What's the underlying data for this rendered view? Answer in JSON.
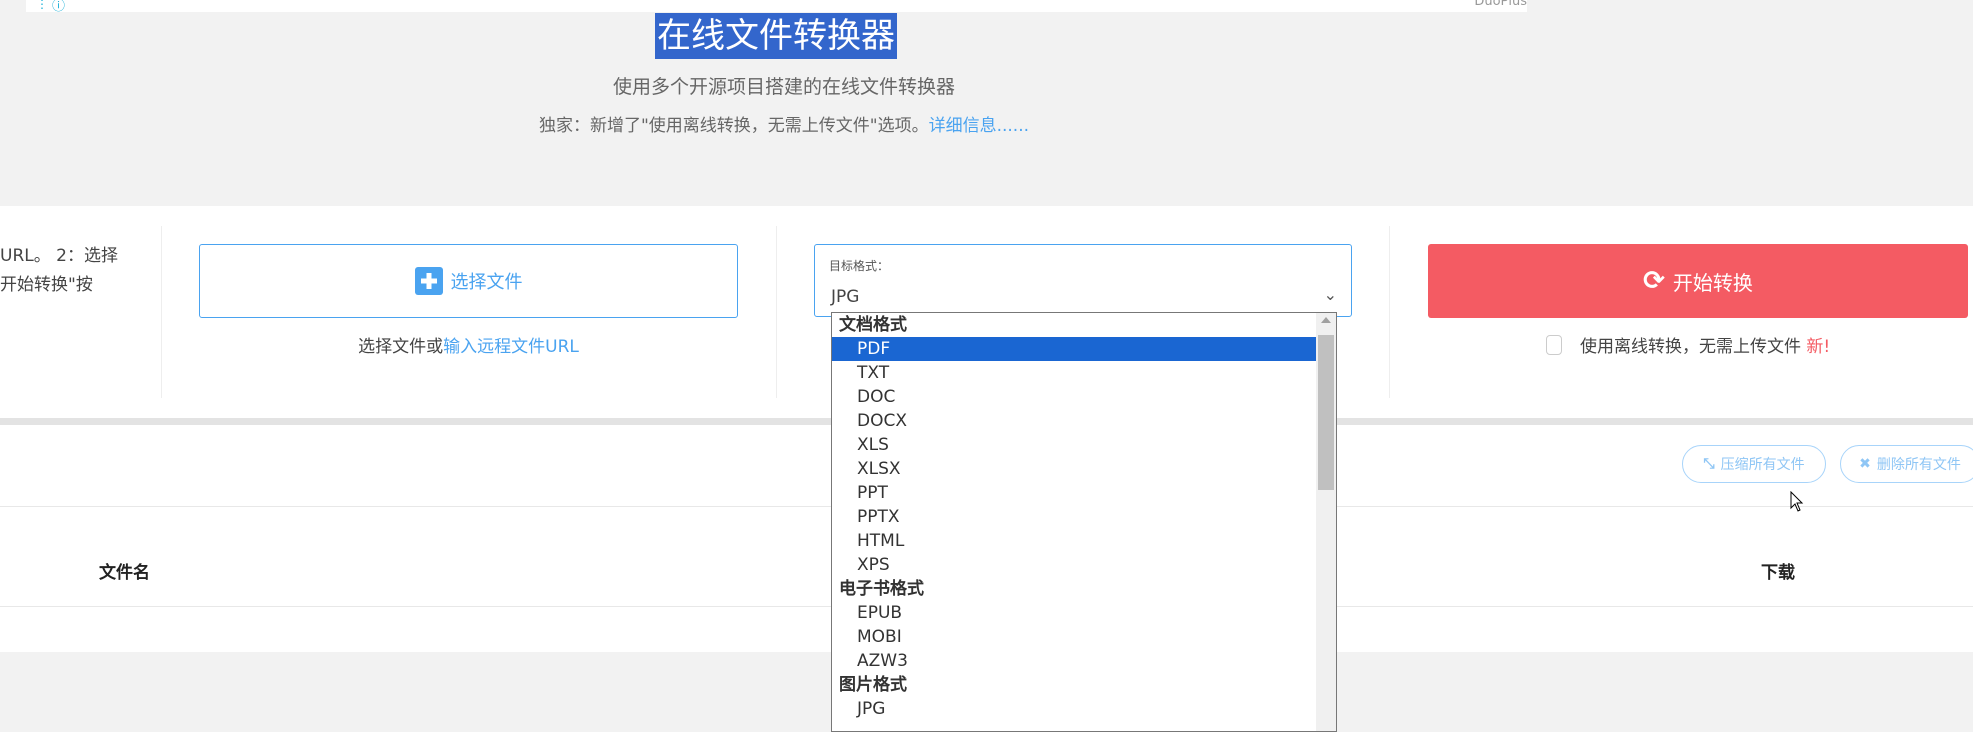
{
  "topbar": {
    "brand": "DuoPlus"
  },
  "header": {
    "title": "在线文件转换器",
    "subtitle": "使用多个开源项目搭建的在线文件转换器",
    "exclusive": "独家：新增了\"使用离线转换，无需上传文件\"选项。",
    "details_link": "详细信息......"
  },
  "steps": {
    "line1": "URL。 2：选择",
    "line2": "开始转换\"按"
  },
  "upload": {
    "button": "选择文件",
    "hint": "选择文件或",
    "remote_link": "输入远程文件URL"
  },
  "format": {
    "label": "目标格式：",
    "value": "JPG",
    "options": [
      {
        "label": "文档格式",
        "group": true
      },
      {
        "label": "PDF",
        "selected": true
      },
      {
        "label": "TXT"
      },
      {
        "label": "DOC"
      },
      {
        "label": "DOCX"
      },
      {
        "label": "XLS"
      },
      {
        "label": "XLSX"
      },
      {
        "label": "PPT"
      },
      {
        "label": "PPTX"
      },
      {
        "label": "HTML"
      },
      {
        "label": "XPS"
      },
      {
        "label": "电子书格式",
        "group": true
      },
      {
        "label": "EPUB"
      },
      {
        "label": "MOBI"
      },
      {
        "label": "AZW3"
      },
      {
        "label": "图片格式",
        "group": true
      },
      {
        "label": "JPG"
      }
    ]
  },
  "convert": {
    "button": "开始转换",
    "offline": "使用离线转换，无需上传文件",
    "new_badge": "新!"
  },
  "files": {
    "compress_all": "压缩所有文件",
    "delete_all": "删除所有文件",
    "col_name": "文件名",
    "col_download": "下载"
  },
  "colors": {
    "accent": "#4aa3f0",
    "start": "#f45b63",
    "selected": "#1a66d2",
    "title_highlight": "#3366cc"
  }
}
